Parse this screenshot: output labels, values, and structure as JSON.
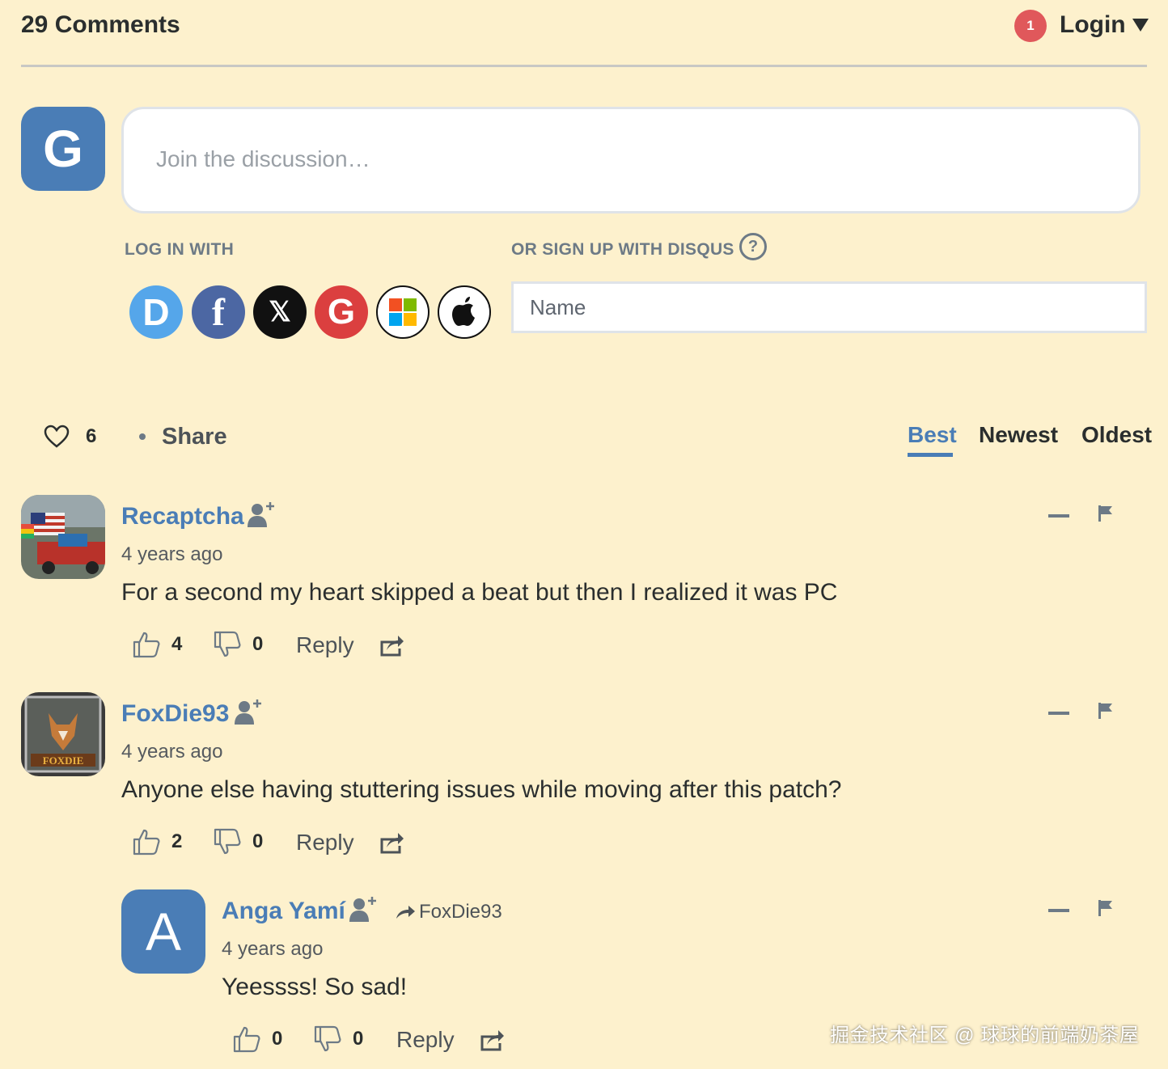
{
  "header": {
    "comment_count_title": "29 Comments",
    "notification_count": "1",
    "login_label": "Login"
  },
  "composer": {
    "user_initial": "G",
    "placeholder": "Join the discussion…",
    "log_in_with_label": "LOG IN WITH",
    "sign_up_label": "OR SIGN UP WITH DISQUS",
    "help_glyph": "?",
    "name_placeholder": "Name",
    "social": [
      {
        "name": "disqus",
        "glyph": "D"
      },
      {
        "name": "facebook",
        "glyph": "f"
      },
      {
        "name": "x",
        "glyph": "𝕏"
      },
      {
        "name": "google",
        "glyph": "G"
      },
      {
        "name": "microsoft",
        "glyph": ""
      },
      {
        "name": "apple",
        "glyph": ""
      }
    ]
  },
  "toolbar": {
    "likes": "6",
    "share_label": "Share",
    "sort_tabs": [
      "Best",
      "Newest",
      "Oldest"
    ],
    "active_tab": "Best"
  },
  "comments": [
    {
      "author": "Recaptcha",
      "time": "4 years ago",
      "text": "For a second my heart skipped a beat but then I realized it was PC",
      "upvotes": "4",
      "downvotes": "0",
      "reply_label": "Reply"
    },
    {
      "author": "FoxDie93",
      "time": "4 years ago",
      "text": "Anyone else having stuttering issues while moving after this patch?",
      "upvotes": "2",
      "downvotes": "0",
      "reply_label": "Reply",
      "avatar_text": "FOXDIE"
    },
    {
      "author": "Anga Yamí",
      "avatar_initial": "A",
      "reply_to": "FoxDie93",
      "time": "4 years ago",
      "text": "Yeessss! So sad!",
      "upvotes": "0",
      "downvotes": "0",
      "reply_label": "Reply"
    }
  ],
  "watermark": "掘金技术社区 @ 球球的前端奶茶屋",
  "colors": {
    "background": "#fdf1cd",
    "accent": "#4a7db6",
    "badge": "#e0585b"
  }
}
